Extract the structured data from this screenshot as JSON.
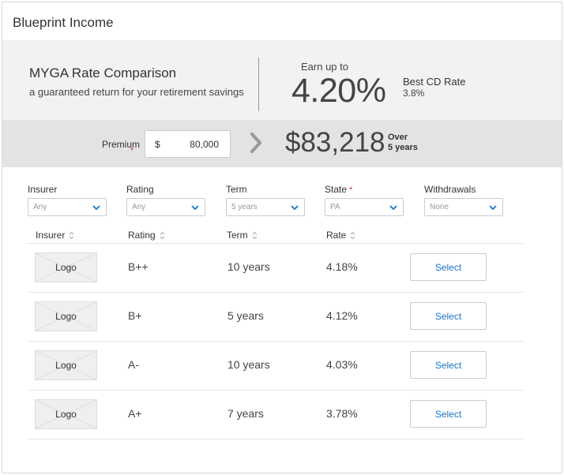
{
  "app_title": "Blueprint Income",
  "hero": {
    "title": "MYGA Rate Comparison",
    "subtitle": "a guaranteed return for your retirement savings",
    "earn_label": "Earn up to",
    "earn_value": "4.20%",
    "cd_label": "Best CD Rate",
    "cd_value": "3.8%"
  },
  "calc": {
    "premium_label": "Premium",
    "required_mark": "*",
    "currency": "$",
    "premium_value": "80,000",
    "total": "$83,218",
    "over_line1": "Over",
    "over_line2": "5 years"
  },
  "filters": [
    {
      "label": "Insurer",
      "value": "Any",
      "required": ""
    },
    {
      "label": "Rating",
      "value": "Any",
      "required": ""
    },
    {
      "label": "Term",
      "value": "5 years",
      "required": ""
    },
    {
      "label": "State",
      "value": "PA",
      "required": "*"
    },
    {
      "label": "Withdrawals",
      "value": "None",
      "required": ""
    }
  ],
  "table": {
    "headers": [
      "Insurer",
      "Rating",
      "Term",
      "Rate"
    ],
    "rows": [
      {
        "logo": "Logo",
        "rating": "B++",
        "term": "10 years",
        "rate": "4.18%",
        "action": "Select"
      },
      {
        "logo": "Logo",
        "rating": "B+",
        "term": "5 years",
        "rate": "4.12%",
        "action": "Select"
      },
      {
        "logo": "Logo",
        "rating": "A-",
        "term": "10 years",
        "rate": "4.03%",
        "action": "Select"
      },
      {
        "logo": "Logo",
        "rating": "A+",
        "term": "7 years",
        "rate": "3.78%",
        "action": "Select"
      }
    ]
  },
  "colors": {
    "accent": "#1a73c8",
    "required": "#dd3333",
    "hero_bg": "#f2f2f2",
    "calc_bg": "#e3e3e3"
  },
  "icons": {
    "dropdown": "chevron-down-icon",
    "sort": "sort-icon",
    "arrow": "chevron-right-icon",
    "logo": "logo-placeholder-icon"
  }
}
